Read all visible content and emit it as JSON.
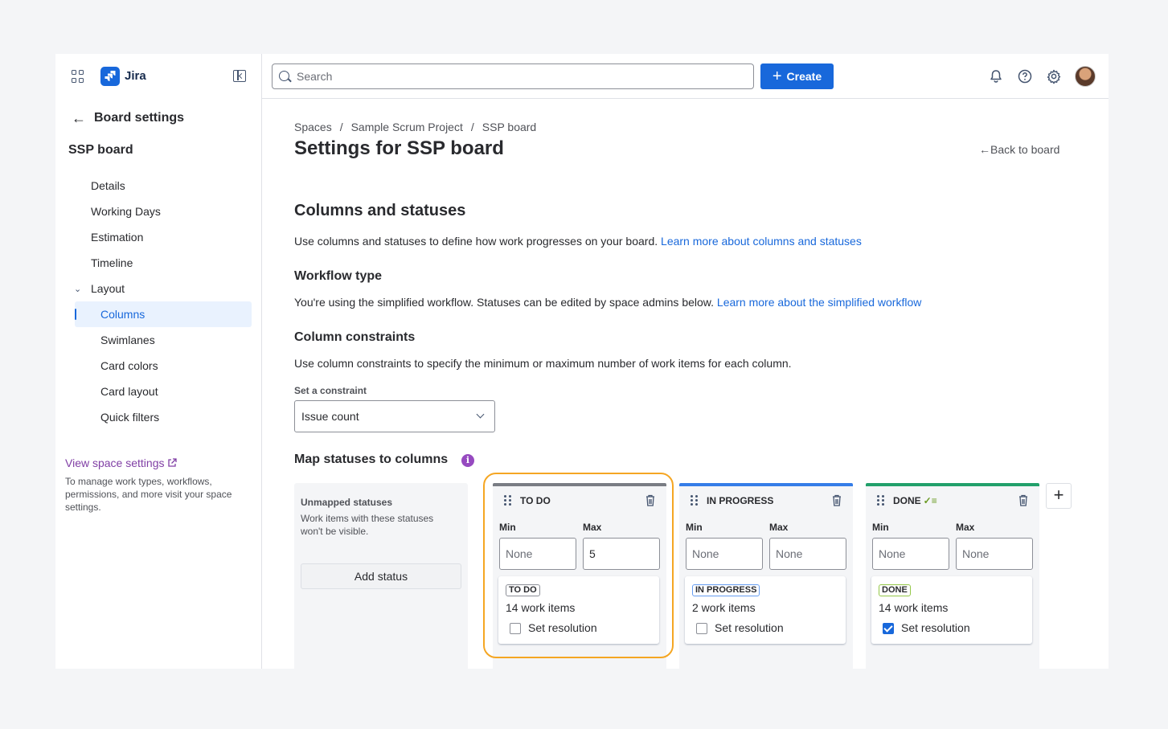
{
  "app": {
    "name": "Jira",
    "accent": "#1868db"
  },
  "sidebar": {
    "back_label": "Board settings",
    "board_name": "SSP board",
    "items": [
      {
        "label": "Details"
      },
      {
        "label": "Working Days"
      },
      {
        "label": "Estimation"
      },
      {
        "label": "Timeline"
      },
      {
        "label": "Layout"
      }
    ],
    "layout_items": [
      {
        "label": "Columns",
        "selected": true
      },
      {
        "label": "Swimlanes"
      },
      {
        "label": "Card colors"
      },
      {
        "label": "Card layout"
      },
      {
        "label": "Quick filters"
      }
    ],
    "view_space_link": "View space settings",
    "view_space_desc": "To manage work types, workflows, permissions, and more visit your space settings."
  },
  "topbar": {
    "search_placeholder": "Search",
    "create_label": "Create",
    "icons": [
      "notifications-icon",
      "help-icon",
      "settings-icon",
      "avatar"
    ]
  },
  "main": {
    "breadcrumbs": [
      "Spaces",
      "/",
      "Sample Scrum Project",
      "/",
      "SSP board"
    ],
    "title": "Settings for SSP board",
    "back_to_board": "Back to board",
    "columns_heading": "Columns and statuses",
    "columns_desc": "Use columns and statuses to define how work progresses on your board.",
    "columns_link": "Learn more about columns and statuses",
    "workflow_heading": "Workflow type",
    "workflow_desc": "You're using the simplified workflow. Statuses can be edited by space admins below.",
    "workflow_link": "Learn more about the simplified workflow",
    "constraints_heading": "Column constraints",
    "constraints_desc": "Use column constraints to specify the minimum or maximum number of work items for each column.",
    "constraint_label": "Set a constraint",
    "constraint_value": "Issue count",
    "map_heading": "Map statuses to columns",
    "unmapped": {
      "title": "Unmapped statuses",
      "desc": "Work items with these statuses won't be visible.",
      "add_label": "Add status"
    },
    "min_label": "Min",
    "max_label": "Max",
    "min_max_placeholder": "None",
    "resolution_label": "Set resolution",
    "columns": [
      {
        "name": "TO DO",
        "bar_color": "#7a7d84",
        "min": "",
        "max": "5",
        "status": "TO DO",
        "count": "14 work items",
        "resolution": false
      },
      {
        "name": "IN PROGRESS",
        "bar_color": "#357de8",
        "min": "",
        "max": "",
        "status": "IN PROGRESS",
        "count": "2 work items",
        "resolution": false
      },
      {
        "name": "DONE",
        "bar_color": "#22a06b",
        "min": "",
        "max": "",
        "status": "DONE",
        "count": "14 work items",
        "resolution": true
      }
    ]
  }
}
